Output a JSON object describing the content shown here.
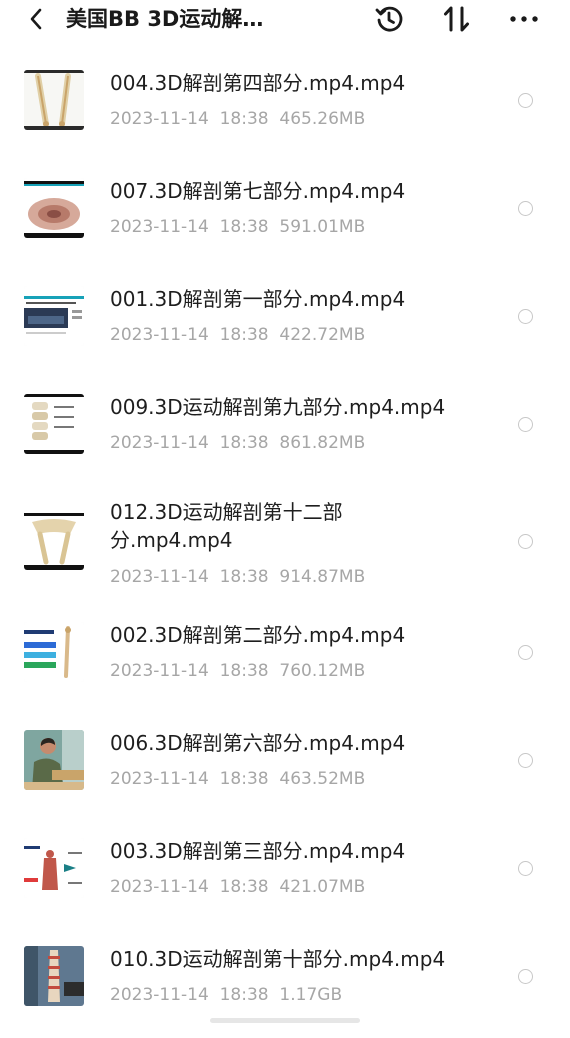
{
  "header": {
    "title": "美国BB 3D运动解…",
    "back_icon": "chevron-left-icon",
    "history_icon": "history-icon",
    "sort_icon": "sort-icon",
    "more_icon": "more-icon"
  },
  "files": [
    {
      "name": "004.3D解剖第四部分.mp4.mp4",
      "date": "2023-11-14",
      "time": "18:38",
      "size": "465.26MB"
    },
    {
      "name": "007.3D解剖第七部分.mp4.mp4",
      "date": "2023-11-14",
      "time": "18:38",
      "size": "591.01MB"
    },
    {
      "name": "001.3D解剖第一部分.mp4.mp4",
      "date": "2023-11-14",
      "time": "18:38",
      "size": "422.72MB"
    },
    {
      "name": "009.3D运动解剖第九部分.mp4.mp4",
      "date": "2023-11-14",
      "time": "18:38",
      "size": "861.82MB"
    },
    {
      "name": "012.3D运动解剖第十二部分.mp4.mp4",
      "date": "2023-11-14",
      "time": "18:38",
      "size": "914.87MB"
    },
    {
      "name": "002.3D解剖第二部分.mp4.mp4",
      "date": "2023-11-14",
      "time": "18:38",
      "size": "760.12MB"
    },
    {
      "name": "006.3D解剖第六部分.mp4.mp4",
      "date": "2023-11-14",
      "time": "18:38",
      "size": "463.52MB"
    },
    {
      "name": "003.3D解剖第三部分.mp4.mp4",
      "date": "2023-11-14",
      "time": "18:38",
      "size": "421.07MB"
    },
    {
      "name": "010.3D运动解剖第十部分.mp4.mp4",
      "date": "2023-11-14",
      "time": "18:38",
      "size": "1.17GB"
    }
  ]
}
